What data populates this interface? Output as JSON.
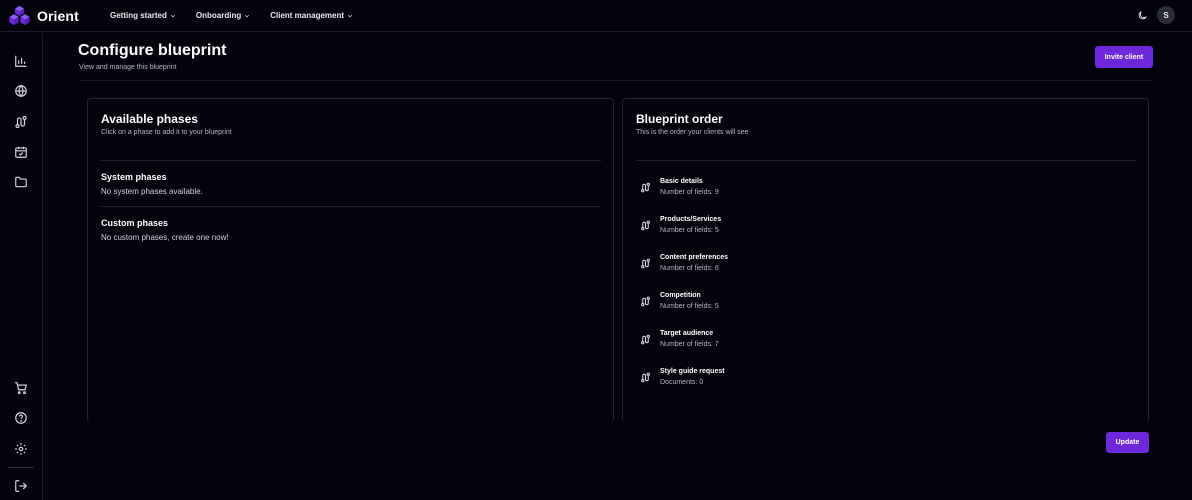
{
  "app": {
    "name": "Orient",
    "brand_color": "#6d28d9",
    "logo_icon": "hexagon-cubes-logo"
  },
  "topnav": {
    "items": [
      {
        "label": "Getting started"
      },
      {
        "label": "Onboarding"
      },
      {
        "label": "Client management"
      }
    ],
    "theme_icon": "moon-icon",
    "avatar_initial": "S"
  },
  "sidebar": {
    "top_icons": [
      "bar-chart-icon",
      "globe-icon",
      "route-icon",
      "calendar-check-icon",
      "folder-icon"
    ],
    "bottom_icons": [
      "cart-icon",
      "help-circle-icon",
      "gear-icon",
      "logout-icon"
    ]
  },
  "header": {
    "title": "Configure blueprint",
    "subtitle": "View and manage this blueprint",
    "invite_label": "Invite client"
  },
  "available": {
    "title": "Available phases",
    "subtitle": "Click on a phase to add it to your blueprint",
    "system_title": "System phases",
    "system_empty": "No system phases available.",
    "custom_title": "Custom phases",
    "custom_empty": "No custom phases, create one now!"
  },
  "order": {
    "title": "Blueprint order",
    "subtitle": "This is the order your clients will see",
    "phases": [
      {
        "name": "Basic details",
        "meta": "Number of fields: 9"
      },
      {
        "name": "Products/Services",
        "meta": "Number of fields: 5"
      },
      {
        "name": "Content preferences",
        "meta": "Number of fields: 6"
      },
      {
        "name": "Competition",
        "meta": "Number of fields: 5"
      },
      {
        "name": "Target audience",
        "meta": "Number of fields: 7"
      },
      {
        "name": "Style guide request",
        "meta": "Documents: 0"
      }
    ]
  },
  "footer": {
    "update_label": "Update"
  }
}
